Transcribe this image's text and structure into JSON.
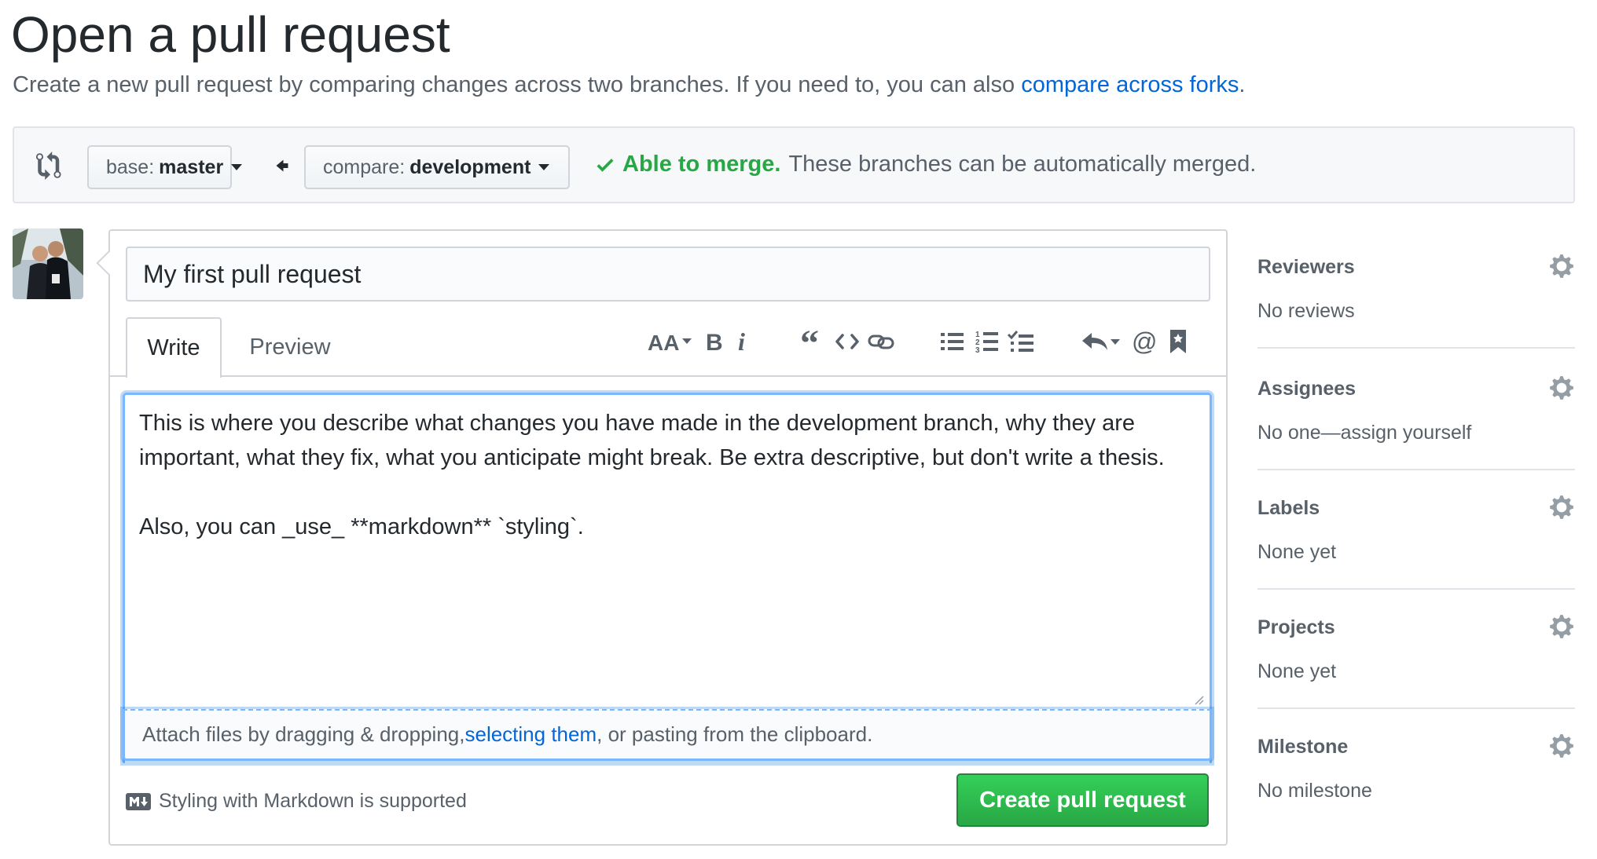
{
  "page": {
    "title": "Open a pull request",
    "subtitle": "Create a new pull request by comparing changes across two branches. If you need to, you can also ",
    "subtitle_link": "compare across forks",
    "subtitle_end": "."
  },
  "compare": {
    "base_label": "base:",
    "base_value": "master",
    "compare_label": "compare:",
    "compare_value": "development",
    "merge_ok": "Able to merge.",
    "merge_msg": "These branches can be automatically merged."
  },
  "editor": {
    "title_value": "My first pull request",
    "tab_write": "Write",
    "tab_preview": "Preview",
    "body": "This is where you describe what changes you have made in the development branch, why they are important, what they fix, what you anticipate might break. Be extra descriptive, but don't write a thesis.\n\nAlso, you can _use_ **markdown** `styling`.",
    "attach_pre": "Attach files by dragging & dropping, ",
    "attach_link": "selecting them",
    "attach_post": ", or pasting from the clipboard.",
    "markdown_note": "Styling with Markdown is supported",
    "create_button": "Create pull request"
  },
  "toolbar": [
    "text-size-icon",
    "bold-icon",
    "italic-icon",
    "quote-icon",
    "code-icon",
    "link-icon",
    "unordered-list-icon",
    "ordered-list-icon",
    "task-list-icon",
    "reply-icon",
    "mention-icon",
    "bookmark-icon"
  ],
  "sidebar": {
    "reviewers": {
      "title": "Reviewers",
      "value": "No reviews"
    },
    "assignees": {
      "title": "Assignees",
      "value": "No one—assign yourself"
    },
    "labels": {
      "title": "Labels",
      "value": "None yet"
    },
    "projects": {
      "title": "Projects",
      "value": "None yet"
    },
    "milestone": {
      "title": "Milestone",
      "value": "No milestone"
    }
  },
  "colors": {
    "accent": "#0366d6",
    "success": "#28a745",
    "text_muted": "#586069"
  }
}
